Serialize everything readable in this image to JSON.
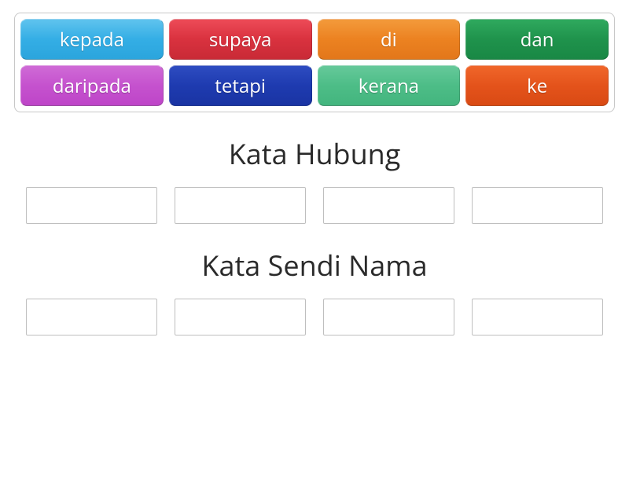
{
  "word_bank": {
    "tiles": [
      {
        "label": "kepada",
        "color": "lightblue"
      },
      {
        "label": "supaya",
        "color": "red"
      },
      {
        "label": "di",
        "color": "orange"
      },
      {
        "label": "dan",
        "color": "green"
      },
      {
        "label": "daripada",
        "color": "magenta"
      },
      {
        "label": "tetapi",
        "color": "blue"
      },
      {
        "label": "kerana",
        "color": "teal"
      },
      {
        "label": "ke",
        "color": "deeporange"
      }
    ]
  },
  "categories": [
    {
      "title": "Kata Hubung",
      "slot_count": 4
    },
    {
      "title": "Kata Sendi Nama",
      "slot_count": 4
    }
  ]
}
